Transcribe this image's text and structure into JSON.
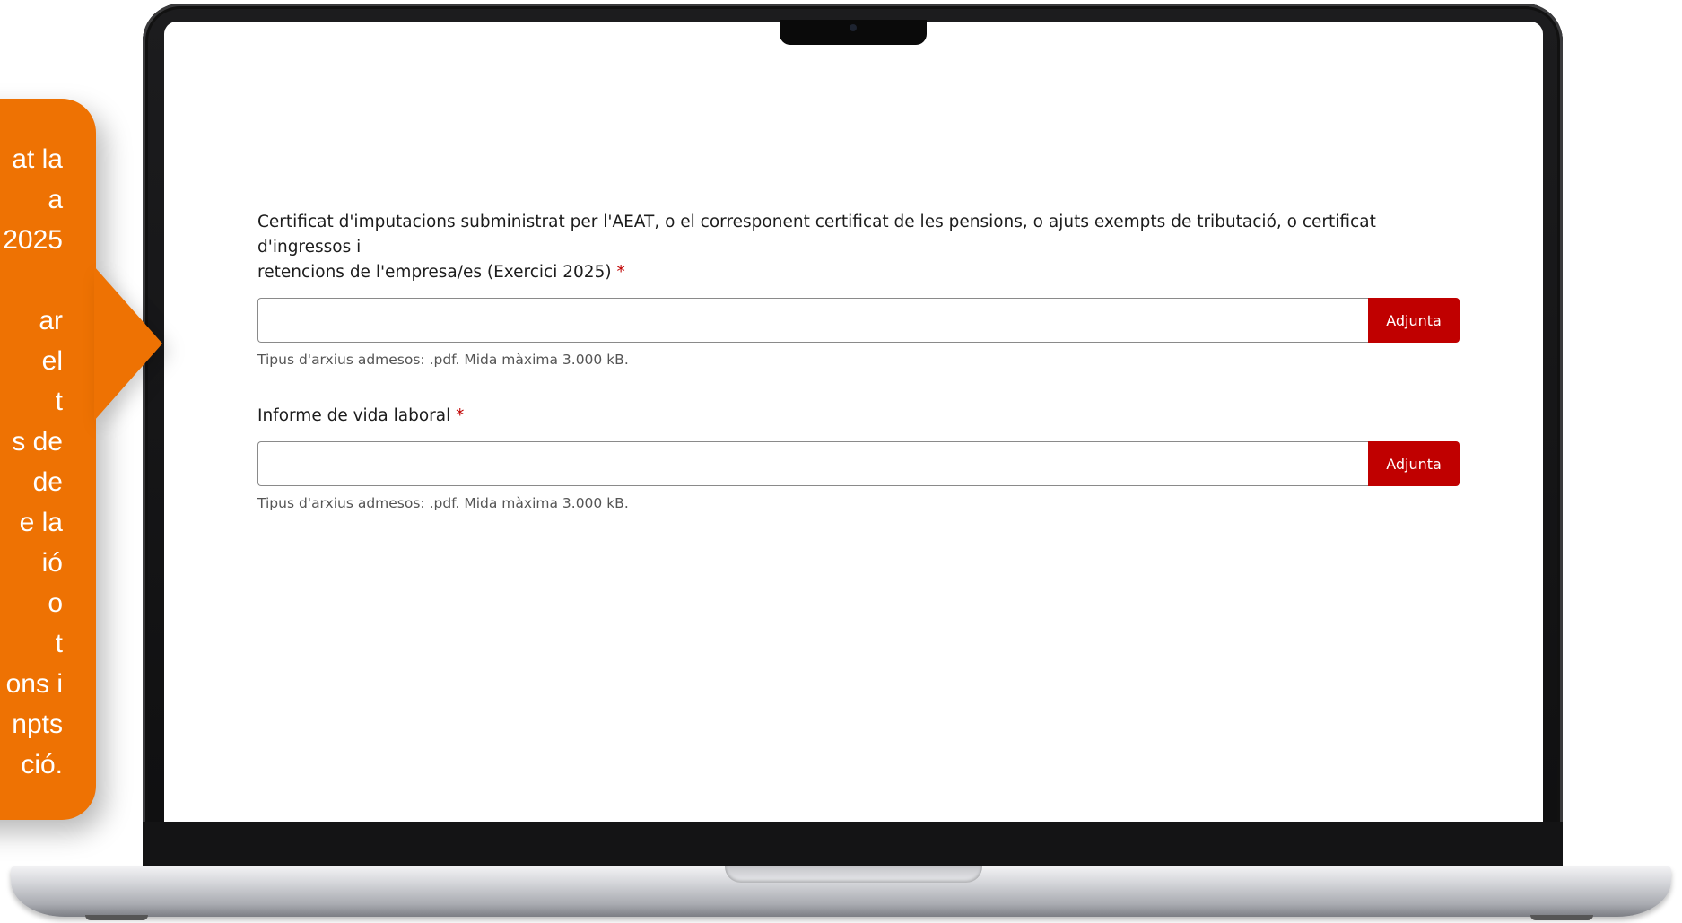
{
  "callout": {
    "text": "at la\na\n2025\n\nar\nel\nt\ns de\n de\ne la\nió\no\nt\nons i\nnpts\nció."
  },
  "form": {
    "fields": [
      {
        "label_line1": "Certificat d'imputacions subministrat per l'AEAT, o el corresponent certificat de les pensions, o ajuts exempts de tributació, o certificat d'ingressos i",
        "label_line2": "retencions de l'empresa/es (Exercici 2025)",
        "required_mark": "*",
        "button_label": "Adjunta",
        "hint": "Tipus d'arxius admesos: .pdf. Mida màxima 3.000 kB."
      },
      {
        "label_line1": "Informe de vida laboral",
        "required_mark": "*",
        "button_label": "Adjunta",
        "hint": "Tipus d'arxius admesos: .pdf. Mida màxima 3.000 kB."
      }
    ]
  },
  "colors": {
    "callout": "#ee7203",
    "button": "#c00000",
    "required": "#c00000"
  }
}
